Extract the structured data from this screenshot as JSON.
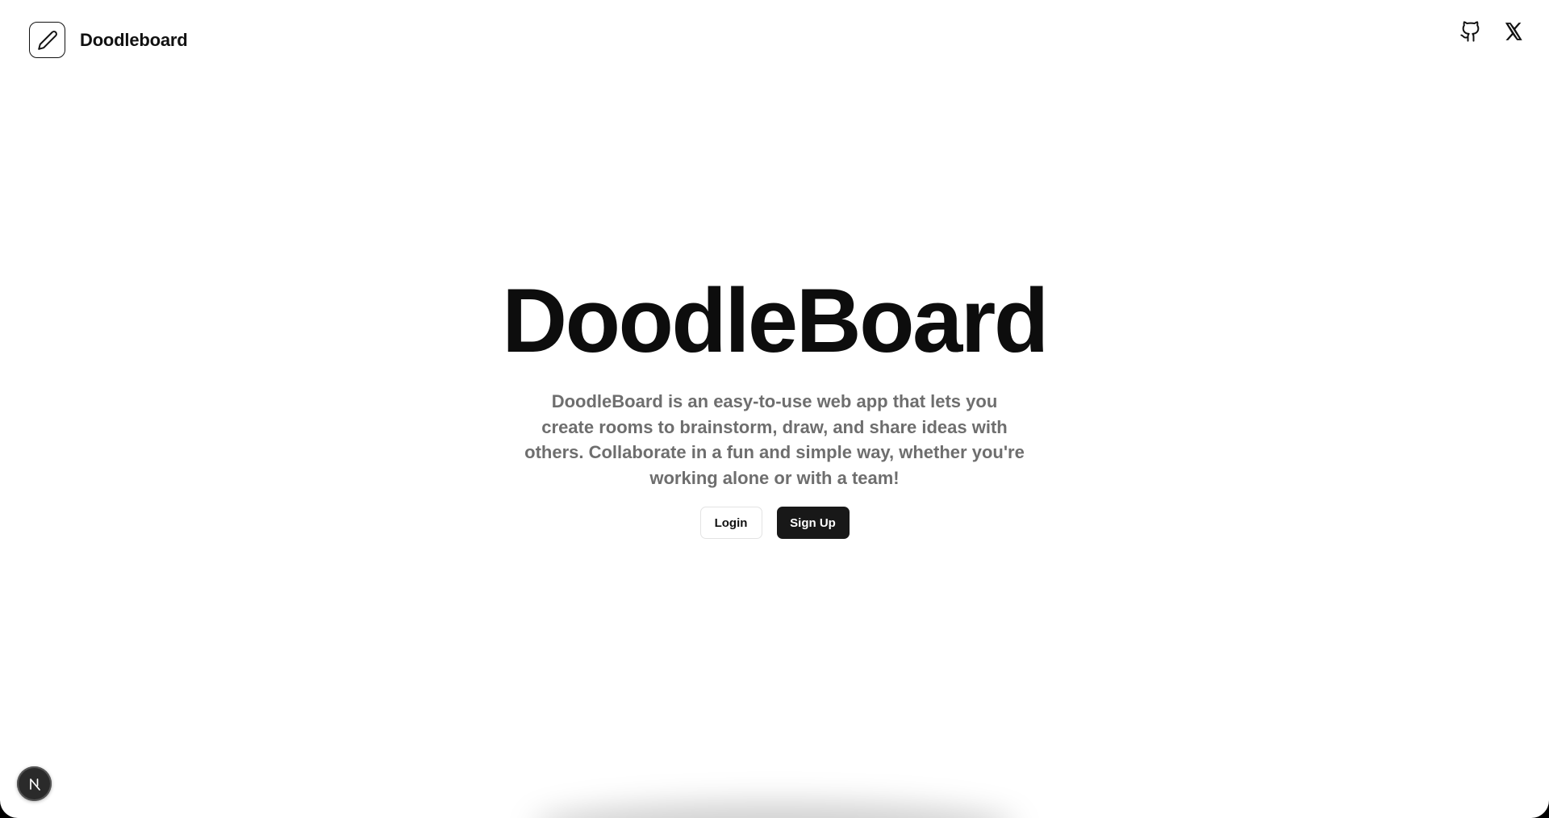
{
  "header": {
    "brand": {
      "name": "Doodleboard",
      "logo_icon": "pencil-icon"
    },
    "social": [
      {
        "icon": "github-icon"
      },
      {
        "icon": "x-icon"
      }
    ]
  },
  "hero": {
    "title": "DoodleBoard",
    "description": "DoodleBoard is an easy-to-use web app that lets you create rooms to brainstorm, draw, and share ideas with others. Collaborate in a fun and simple way, whether you're working alone or with a team!",
    "login_label": "Login",
    "signup_label": "Sign Up"
  },
  "dev_indicator": {
    "icon": "nextjs-icon"
  },
  "colors": {
    "text_primary": "#111111",
    "text_secondary": "#6e6e6e",
    "button_dark": "#181818"
  }
}
